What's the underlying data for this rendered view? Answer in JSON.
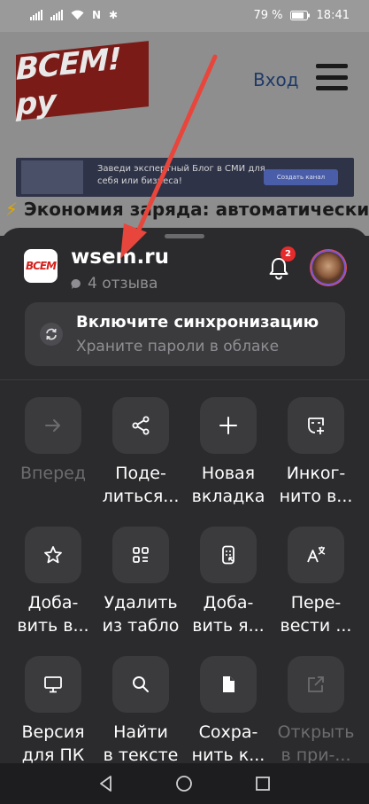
{
  "status_bar": {
    "battery_percent": "79 %",
    "time": "18:41"
  },
  "webpage": {
    "logo_text": "ВСЕМ!ру",
    "login_link": "Вход",
    "banner": {
      "text": "Заведи экспертный Блог в СМИ для себя или бизнеса!",
      "button": "Создать канал"
    },
    "headline": "Экономия заряда: автоматически"
  },
  "sheet": {
    "site_logo_text": "ВСЕМ",
    "site_name": "wsem.ru",
    "reviews": "4 отзыва",
    "notifications_count": "2",
    "sync": {
      "title": "Включите синхронизацию",
      "subtitle": "Храните пароли в облаке"
    },
    "actions": [
      {
        "line1": "Вперед",
        "line2": "",
        "icon": "arrow-right-icon",
        "enabled": false
      },
      {
        "line1": "Поде-",
        "line2": "литься...",
        "icon": "share-icon",
        "enabled": true
      },
      {
        "line1": "Новая",
        "line2": "вкладка",
        "icon": "plus-icon",
        "enabled": true
      },
      {
        "line1": "Инког-",
        "line2": "нито в...",
        "icon": "incognito-icon",
        "enabled": true
      },
      {
        "line1": "Доба-",
        "line2": "вить в...",
        "icon": "star-icon",
        "enabled": true
      },
      {
        "line1": "Удалить",
        "line2": "из табло",
        "icon": "dashboard-icon",
        "enabled": true
      },
      {
        "line1": "Доба-",
        "line2": "вить я...",
        "icon": "app-shortcut-icon",
        "enabled": true
      },
      {
        "line1": "Пере-",
        "line2": "вести ...",
        "icon": "translate-icon",
        "enabled": true
      },
      {
        "line1": "Версия",
        "line2": "для ПК",
        "icon": "desktop-icon",
        "enabled": true
      },
      {
        "line1": "Найти",
        "line2": "в тексте",
        "icon": "search-icon",
        "enabled": true
      },
      {
        "line1": "Сохра-",
        "line2": "нить к...",
        "icon": "document-icon",
        "enabled": true
      },
      {
        "line1": "Открыть",
        "line2": "в при-...",
        "icon": "open-external-icon",
        "enabled": false
      }
    ]
  }
}
